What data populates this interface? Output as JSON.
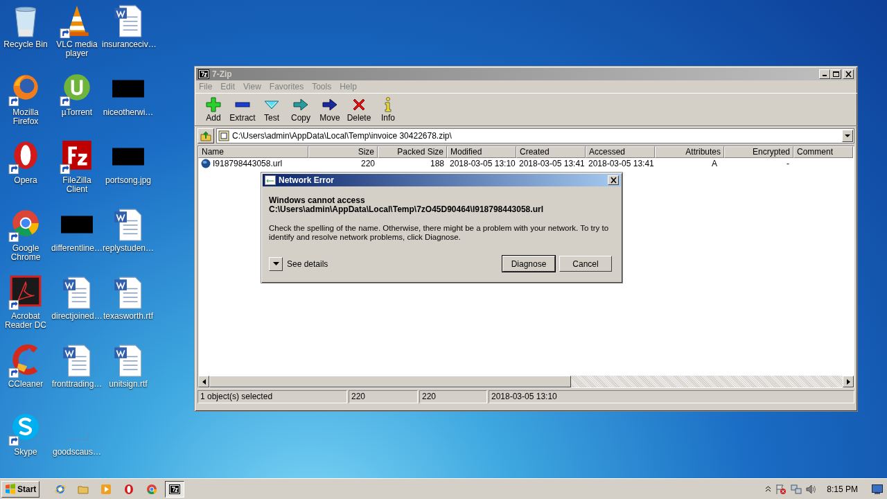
{
  "desktop": {
    "icons": [
      {
        "label": "Recycle Bin",
        "kind": "recycle",
        "shortcut": false
      },
      {
        "label": "VLC media player",
        "kind": "vlc",
        "shortcut": true
      },
      {
        "label": "insuranceciv…",
        "kind": "word",
        "shortcut": false
      },
      {
        "label": "Mozilla Firefox",
        "kind": "firefox",
        "shortcut": true
      },
      {
        "label": "µTorrent",
        "kind": "utorrent",
        "shortcut": true
      },
      {
        "label": "niceotherwi…",
        "kind": "thumb",
        "shortcut": false
      },
      {
        "label": "Opera",
        "kind": "opera",
        "shortcut": true
      },
      {
        "label": "FileZilla Client",
        "kind": "filezilla",
        "shortcut": true
      },
      {
        "label": "portsong.jpg",
        "kind": "thumb",
        "shortcut": false
      },
      {
        "label": "Google Chrome",
        "kind": "chrome",
        "shortcut": true
      },
      {
        "label": "differentline…",
        "kind": "thumb",
        "shortcut": false
      },
      {
        "label": "replystuden…",
        "kind": "word",
        "shortcut": false
      },
      {
        "label": "Acrobat Reader DC",
        "kind": "acrobat",
        "shortcut": true
      },
      {
        "label": "directjoined…",
        "kind": "word",
        "shortcut": false
      },
      {
        "label": "texasworth.rtf",
        "kind": "word",
        "shortcut": false
      },
      {
        "label": "CCleaner",
        "kind": "ccleaner",
        "shortcut": true
      },
      {
        "label": "fronttrading…",
        "kind": "word",
        "shortcut": false
      },
      {
        "label": "unitsign.rtf",
        "kind": "word",
        "shortcut": false
      },
      {
        "label": "Skype",
        "kind": "skype",
        "shortcut": true
      },
      {
        "label": "goodscaus…",
        "kind": "blank",
        "shortcut": false
      }
    ]
  },
  "window": {
    "title": "7-Zip",
    "active": false,
    "menu": [
      {
        "label": "File",
        "disabled": true
      },
      {
        "label": "Edit",
        "disabled": true
      },
      {
        "label": "View",
        "disabled": true
      },
      {
        "label": "Favorites",
        "disabled": true
      },
      {
        "label": "Tools",
        "disabled": true
      },
      {
        "label": "Help",
        "disabled": true
      }
    ],
    "toolbar": [
      {
        "label": "Add",
        "kind": "add"
      },
      {
        "label": "Extract",
        "kind": "extract"
      },
      {
        "label": "Test",
        "kind": "test"
      },
      {
        "label": "Copy",
        "kind": "copy"
      },
      {
        "label": "Move",
        "kind": "move"
      },
      {
        "label": "Delete",
        "kind": "delete"
      },
      {
        "label": "Info",
        "kind": "info"
      }
    ],
    "address": "C:\\Users\\admin\\AppData\\Local\\Temp\\invoice 30422678.zip\\",
    "table": {
      "columns": [
        "Name",
        "Size",
        "Packed Size",
        "Modified",
        "Created",
        "Accessed",
        "Attributes",
        "Encrypted",
        "Comment"
      ],
      "rows": [
        {
          "cells": [
            "I918798443058.url",
            "220",
            "188",
            "2018-03-05 13:10",
            "2018-03-05 13:41",
            "2018-03-05 13:41",
            "A",
            "-"
          ]
        }
      ]
    },
    "status_bar": [
      "1 object(s) selected",
      "220",
      "220",
      "2018-03-05 13:10"
    ]
  },
  "dialog": {
    "title": "Network Error",
    "active": true,
    "heading": "Windows cannot access",
    "path": "C:\\Users\\admin\\AppData\\Local\\Temp\\7zO45D90464\\I918798443058.url",
    "message": "Check the spelling of the name. Otherwise, there might be a problem with your network. To try to identify and resolve network problems, click Diagnose.",
    "details_label": "See details",
    "buttons": [
      {
        "label": "Diagnose",
        "default": true
      },
      {
        "label": "Cancel",
        "default": false
      }
    ]
  },
  "taskbar": {
    "start": "Start",
    "apps": [
      {
        "kind": "ie",
        "active": false
      },
      {
        "kind": "folder",
        "active": false
      },
      {
        "kind": "media",
        "active": false
      },
      {
        "kind": "opera",
        "active": false
      },
      {
        "kind": "chrome",
        "active": false
      },
      {
        "kind": "sevenzip",
        "active": true
      }
    ],
    "clock": "8:15 PM"
  }
}
